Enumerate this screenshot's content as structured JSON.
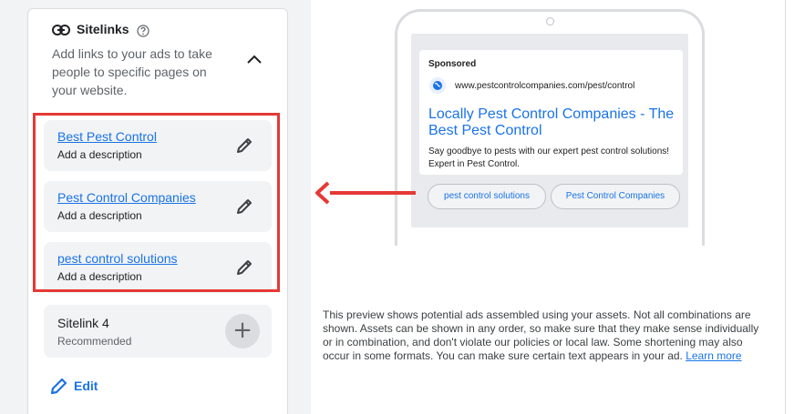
{
  "sitelinks": {
    "title": "Sitelinks",
    "description": "Add links to your ads to take people to specific pages on your website.",
    "items": [
      {
        "title": "Best Pest Control",
        "description": "Add a description"
      },
      {
        "title": "Pest Control Companies",
        "description": "Add a description"
      },
      {
        "title": "pest control solutions",
        "description": "Add a description"
      }
    ],
    "slot4": {
      "title": "Sitelink 4",
      "subtitle": "Recommended",
      "add_symbol": "+"
    },
    "edit_label": "Edit"
  },
  "preview": {
    "sponsored": "Sponsored",
    "url": "www.pestcontrolcompanies.com/pest/control",
    "ad_title": "Locally Pest Control Companies - The Best Pest Control",
    "ad_description": "Say goodbye to pests with our expert pest control solutions! Expert in Pest Control.",
    "chips": [
      "pest control solutions",
      "Pest Control Companies"
    ]
  },
  "note": {
    "text": "This preview shows potential ads assembled using your assets. Not all combinations are shown. Assets can be shown in any order, so make sure that they make sense individually or in combination, and don't violate our policies or local law. Some shortening may also occur in some formats. You can make sure certain text appears in your ad. ",
    "link": "Learn more"
  },
  "colors": {
    "accent": "#1a73e8",
    "highlight": "#e53935"
  }
}
